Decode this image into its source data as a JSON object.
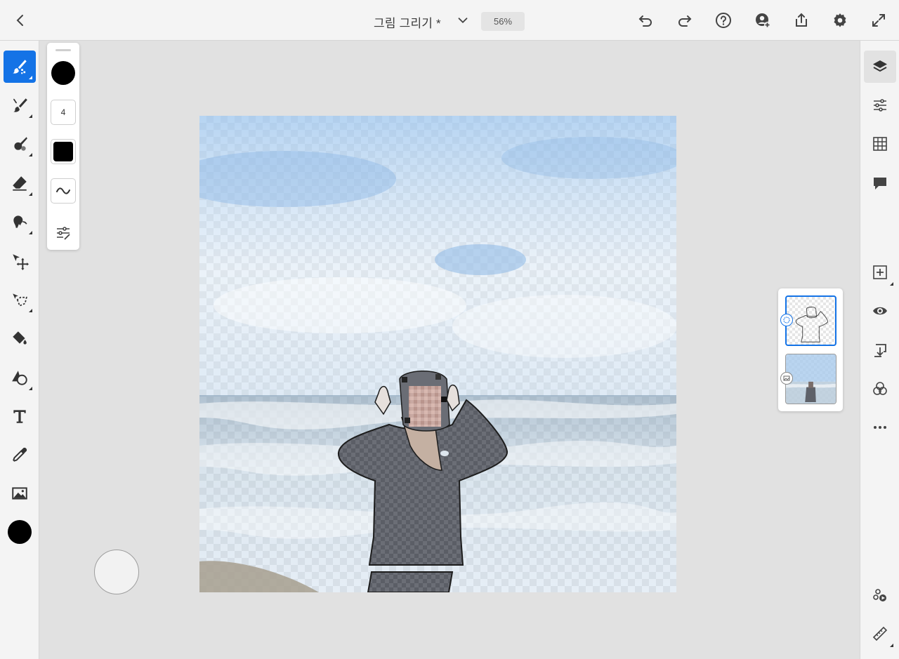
{
  "header": {
    "title": "그림 그리기 *",
    "zoom": "56%"
  },
  "brush_panel": {
    "size_value": "4",
    "color": "#000000"
  },
  "left_tools": [
    {
      "name": "pixel-brush",
      "active": true
    },
    {
      "name": "live-brush"
    },
    {
      "name": "mixer-brush"
    },
    {
      "name": "eraser"
    },
    {
      "name": "smudge"
    },
    {
      "name": "move"
    },
    {
      "name": "lasso"
    },
    {
      "name": "fill"
    },
    {
      "name": "shapes"
    },
    {
      "name": "text"
    },
    {
      "name": "eyedropper"
    },
    {
      "name": "place-image"
    }
  ],
  "colors": {
    "accent": "#1473e6",
    "primary_color": "#000000"
  },
  "layers": [
    {
      "type": "drawing",
      "selected": true
    },
    {
      "type": "image",
      "selected": false
    }
  ]
}
